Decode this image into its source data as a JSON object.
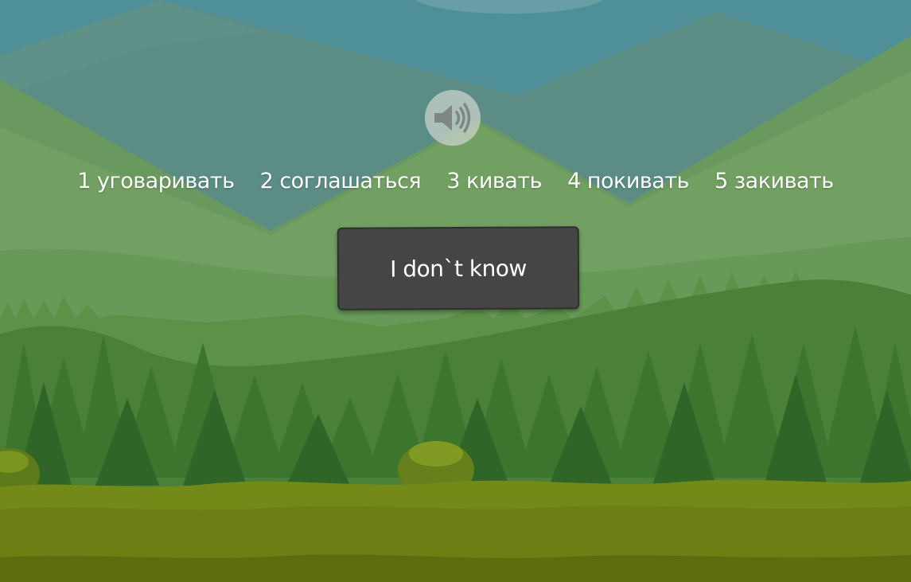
{
  "sound": {
    "icon": "speaker-icon"
  },
  "options": [
    {
      "label": "1 уговаривать"
    },
    {
      "label": "2 соглашаться"
    },
    {
      "label": "3 кивать"
    },
    {
      "label": "4 покивать"
    },
    {
      "label": "5 закивать"
    }
  ],
  "dont_know": {
    "label": "I don`t know"
  },
  "colors": {
    "sky": "#4f8f98",
    "far_mountain": "#5a8c84",
    "mid_hill": "#6f9a5c",
    "forest": "#3e7a32",
    "ground": "#6f7f16",
    "button": "#454545"
  }
}
